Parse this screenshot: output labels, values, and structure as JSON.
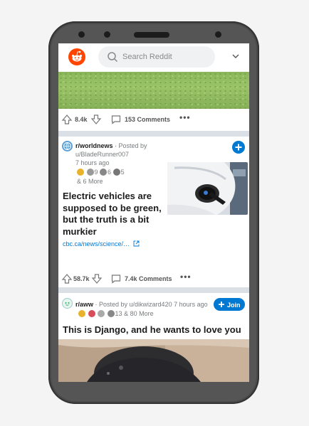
{
  "search": {
    "placeholder": "Search Reddit"
  },
  "posts": [
    {
      "score": "8.4k",
      "comments": "153 Comments"
    },
    {
      "subreddit": "r/worldnews",
      "posted_by_prefix": " · Posted by",
      "user": "u/BladeRunner007",
      "time": "7 hours ago",
      "award_counts": [
        "9",
        "6",
        "5"
      ],
      "more_awards": "& 6 More",
      "title": "Electric vehicles are supposed to be green, but the truth is a bit murkier",
      "link": "cbc.ca/news/science/…",
      "score": "58.7k",
      "comments": "7.4k Comments"
    },
    {
      "subreddit": "r/aww",
      "posted_by": " · Posted by u/dikwizard420 7 hours ago",
      "award_count": "13",
      "more_awards": "& 80 More",
      "join_label": "Join",
      "title": "This is Django, and he wants to love you"
    }
  ],
  "colors": {
    "accent": "#0079d3",
    "reddit_orange": "#ff4500"
  }
}
